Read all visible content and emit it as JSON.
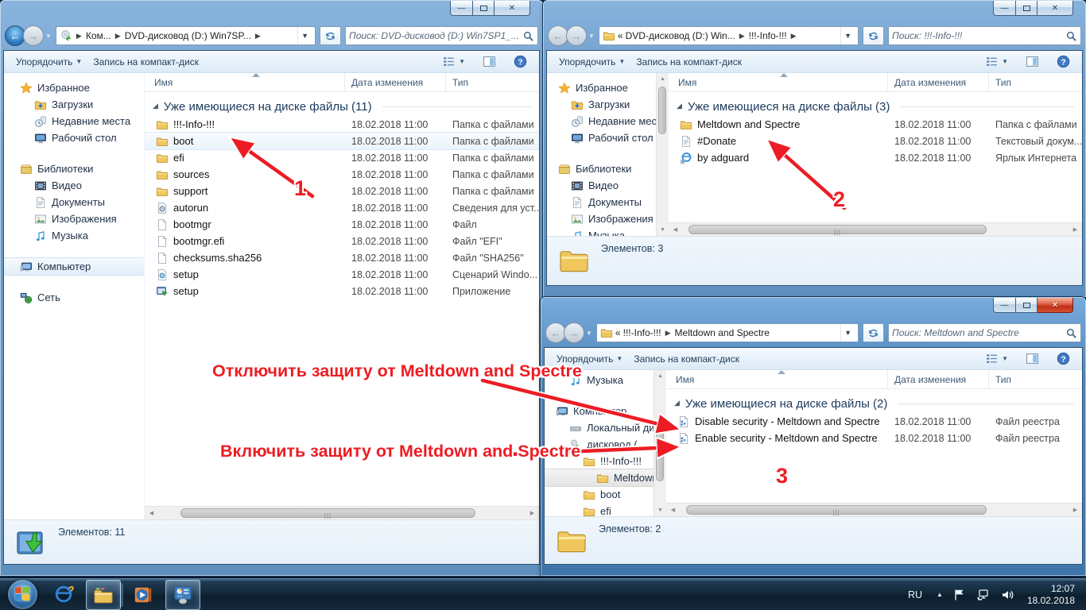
{
  "common": {
    "toolbar": {
      "organize": "Упорядочить",
      "burn": "Запись на компакт-диск"
    },
    "columns": {
      "name": "Имя",
      "date": "Дата изменения",
      "type": "Тип"
    }
  },
  "sidebar": {
    "favorites": "Избранное",
    "downloads": "Загрузки",
    "recent": "Недавние места",
    "desktop": "Рабочий стол",
    "libraries": "Библиотеки",
    "video": "Видео",
    "documents": "Документы",
    "pictures": "Изображения",
    "music": "Музыка",
    "computer": "Компьютер",
    "network": "Сеть"
  },
  "windows": {
    "left": {
      "crumb1": "Ком...",
      "crumb2": "DVD-дисковод (D:) Win7SP...",
      "search_placeholder": "Поиск: DVD-дисковод (D:) Win7SP1_...",
      "group_header": "Уже имеющиеся на диске файлы (11)",
      "status": "Элементов: 11",
      "files": [
        {
          "icon": "folder",
          "name": "!!!-Info-!!!",
          "date": "18.02.2018 11:00",
          "type": "Папка с файлами"
        },
        {
          "icon": "folder",
          "name": "boot",
          "date": "18.02.2018 11:00",
          "type": "Папка с файлами",
          "state": "hover"
        },
        {
          "icon": "folder",
          "name": "efi",
          "date": "18.02.2018 11:00",
          "type": "Папка с файлами"
        },
        {
          "icon": "folder",
          "name": "sources",
          "date": "18.02.2018 11:00",
          "type": "Папка с файлами"
        },
        {
          "icon": "folder",
          "name": "support",
          "date": "18.02.2018 11:00",
          "type": "Папка с файлами"
        },
        {
          "icon": "gearfile",
          "name": "autorun",
          "date": "18.02.2018 11:00",
          "type": "Сведения для уст..."
        },
        {
          "icon": "file",
          "name": "bootmgr",
          "date": "18.02.2018 11:00",
          "type": "Файл"
        },
        {
          "icon": "file",
          "name": "bootmgr.efi",
          "date": "18.02.2018 11:00",
          "type": "Файл \"EFI\""
        },
        {
          "icon": "file",
          "name": "checksums.sha256",
          "date": "18.02.2018 11:00",
          "type": "Файл \"SHA256\""
        },
        {
          "icon": "script",
          "name": "setup",
          "date": "18.02.2018 11:00",
          "type": "Сценарий Windo..."
        },
        {
          "icon": "app",
          "name": "setup",
          "date": "18.02.2018 11:00",
          "type": "Приложение"
        }
      ]
    },
    "top_right": {
      "chev": "«",
      "crumb1": "DVD-дисковод (D:) Win...",
      "crumb2": "!!!-Info-!!!",
      "search_placeholder": "Поиск: !!!-Info-!!!",
      "group_header": "Уже имеющиеся на диске файлы (3)",
      "status": "Элементов: 3",
      "files": [
        {
          "icon": "folder",
          "name": "Meltdown and Spectre",
          "date": "18.02.2018 11:00",
          "type": "Папка с файлами"
        },
        {
          "icon": "textfile",
          "name": "#Donate",
          "date": "18.02.2018 11:00",
          "type": "Текстовый докум..."
        },
        {
          "icon": "iesc",
          "name": "by adguard",
          "date": "18.02.2018 11:00",
          "type": "Ярлык Интернета"
        }
      ]
    },
    "bottom_right": {
      "chev": "«",
      "crumb1": "!!!-Info-!!!",
      "crumb2": "Meltdown and Spectre",
      "search_placeholder": "Поиск: Meltdown and Spectre",
      "group_header": "Уже имеющиеся на диске файлы (2)",
      "status": "Элементов: 2",
      "files": [
        {
          "icon": "reg",
          "name": "Disable security - Meltdown and Spectre",
          "date": "18.02.2018 11:00",
          "type": "Файл реестра"
        },
        {
          "icon": "reg",
          "name": "Enable security - Meltdown and Spectre",
          "date": "18.02.2018 11:00",
          "type": "Файл реестра"
        }
      ],
      "tree": [
        {
          "icon": "music",
          "label": "Музыка",
          "indent": 1
        },
        {
          "icon": "gap",
          "label": "",
          "indent": 0
        },
        {
          "icon": "computer",
          "label": "Компьютер",
          "indent": 0
        },
        {
          "icon": "hdd",
          "label": "Локальный диск",
          "indent": 1
        },
        {
          "icon": "dvddrive",
          "label": "дисковод (",
          "indent": 1
        },
        {
          "icon": "folder",
          "label": "!!!-Info-!!!",
          "indent": 2
        },
        {
          "icon": "folder",
          "label": "Meltdown an",
          "indent": 3,
          "state": "gray-sel"
        },
        {
          "icon": "folder",
          "label": "boot",
          "indent": 2
        },
        {
          "icon": "folder",
          "label": "efi",
          "indent": 2
        }
      ]
    }
  },
  "annotations": {
    "disable_text": "Отключить защиту от Meltdown and Spectre",
    "enable_text": "Включить защиту от Meltdown and Spectre",
    "label1": "1",
    "label2": "2",
    "label3": "3",
    "arrow_color": "#ed1c24"
  },
  "taskbar": {
    "tray_lang": "RU",
    "time": "12:07",
    "date": "18.02.2018"
  }
}
